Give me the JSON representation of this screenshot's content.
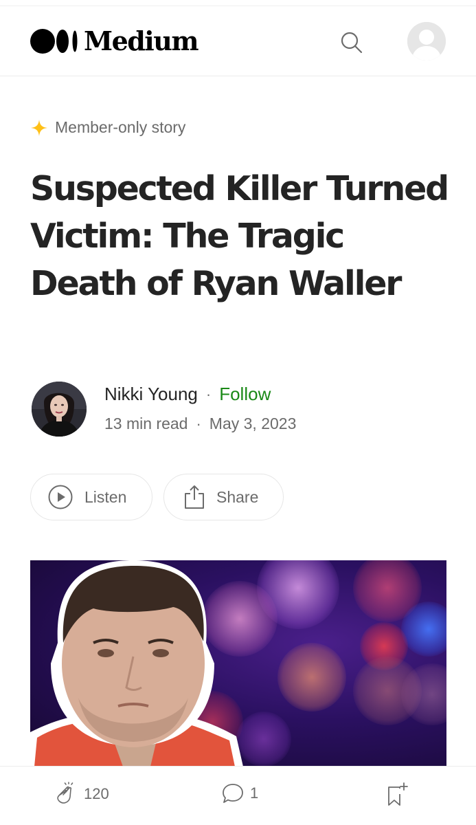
{
  "header": {
    "logo_text": "Medium",
    "search_icon": "search-icon",
    "avatar_icon": "user-avatar-placeholder"
  },
  "article": {
    "member_badge": "Member-only story",
    "member_badge_icon": "sparkle-star-icon",
    "member_badge_color": "#ffc017",
    "title": "Suspected Killer Turned Victim: The Tragic Death of Ryan Waller",
    "author": {
      "name": "Nikki Young",
      "separator": "·",
      "follow_label": "Follow",
      "follow_color": "#1a8917"
    },
    "meta": {
      "read_time": "13 min read",
      "separator": "·",
      "date": "May 3, 2023"
    },
    "actions": {
      "listen_label": "Listen",
      "listen_icon": "play-circle-icon",
      "share_label": "Share",
      "share_icon": "share-icon"
    },
    "hero_image": "mugshot-on-bokeh-background"
  },
  "bottom_bar": {
    "claps": "120",
    "clap_icon": "clap-icon",
    "comments": "1",
    "comment_icon": "comment-bubble-icon",
    "bookmark_icon": "bookmark-add-icon"
  }
}
